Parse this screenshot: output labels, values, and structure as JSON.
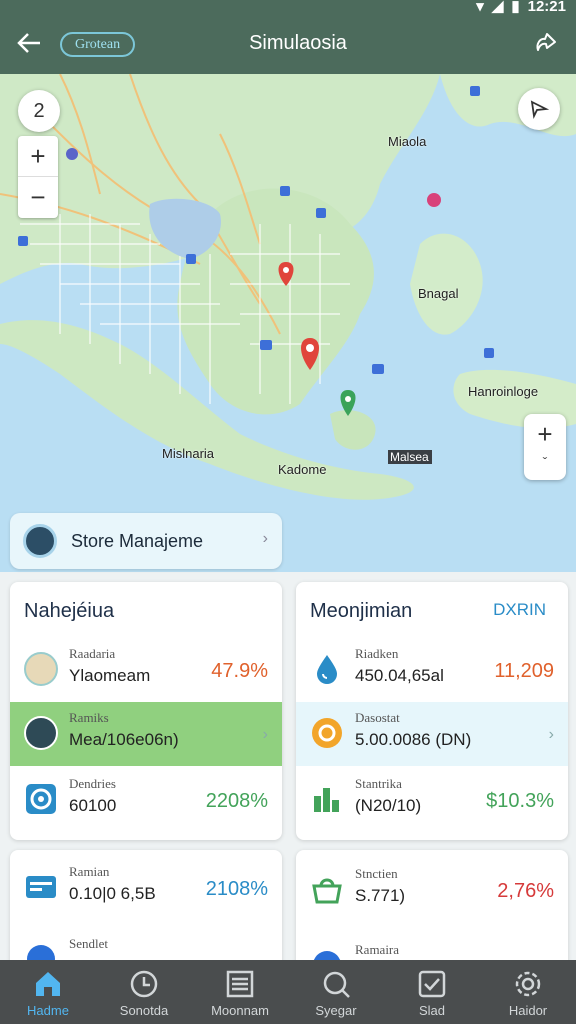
{
  "status_bar": {
    "time": "12:21"
  },
  "app_bar": {
    "chip": "Grotean",
    "title": "Simulaosia"
  },
  "map": {
    "zoom_badge": "2",
    "zoom_in": "+",
    "zoom_out": "−",
    "right_zoom_in": "+",
    "right_zoom_out": "ˇ",
    "labels": {
      "miaola": "Miaola",
      "bnagal": "Bnagal",
      "hanroinloge": "Hanroinloge",
      "mislnaria": "Mislnaria",
      "kadome": "Kadome",
      "malsea": "Malsea"
    }
  },
  "store_bar": {
    "label": "Store Manajeme"
  },
  "left_card": {
    "title": "Nahejéiua",
    "rows": [
      {
        "l1": "Raadaria",
        "l2": "Ylaomeam",
        "value": "47.9%",
        "value_color": "#e0612c"
      },
      {
        "l1": "Ramiks",
        "l2": "Mea/106e06n)",
        "value": "",
        "value_color": ""
      },
      {
        "l1": "Dendries",
        "l2": "60100",
        "value": "2208%",
        "value_color": "#43a35a"
      }
    ]
  },
  "right_card": {
    "title": "Meonjimian",
    "tag": "DXRIN",
    "rows": [
      {
        "l1": "Riadken",
        "l2": "450.04,65al",
        "value": "11,209",
        "value_color": "#e0612c"
      },
      {
        "l1": "Dasostat",
        "l2": "5.00.0086 (DN)",
        "value": "",
        "value_color": ""
      },
      {
        "l1": "Stantrika",
        "l2": "(N20/10)",
        "value": "$10.3%",
        "value_color": "#43a35a"
      }
    ]
  },
  "left_card2": {
    "rows": [
      {
        "l1": "Ramian",
        "l2": "0.10|0 6,5B",
        "value": "2108%",
        "value_color": "#2a8cc7"
      },
      {
        "l1": "Sendlet",
        "l2": "",
        "value": "",
        "value_color": ""
      }
    ]
  },
  "right_card2": {
    "rows": [
      {
        "l1": "Stnctien",
        "l2": "S.771)",
        "value": "2,76%",
        "value_color": "#d63a3a"
      },
      {
        "l1": "Ramaira",
        "l2": "",
        "value": "",
        "value_color": ""
      }
    ]
  },
  "bottom_nav": [
    {
      "label": "Hadme",
      "icon": "home-icon"
    },
    {
      "label": "Sonotda",
      "icon": "clock-icon"
    },
    {
      "label": "Moonnam",
      "icon": "list-icon"
    },
    {
      "label": "Syegar",
      "icon": "search-icon"
    },
    {
      "label": "Slad",
      "icon": "checkbox-icon"
    },
    {
      "label": "Haidor",
      "icon": "settings-icon"
    }
  ],
  "colors": {
    "accent": "#52b6f0",
    "appbar": "#4c6b5c",
    "navbar": "#4a4d4e"
  }
}
